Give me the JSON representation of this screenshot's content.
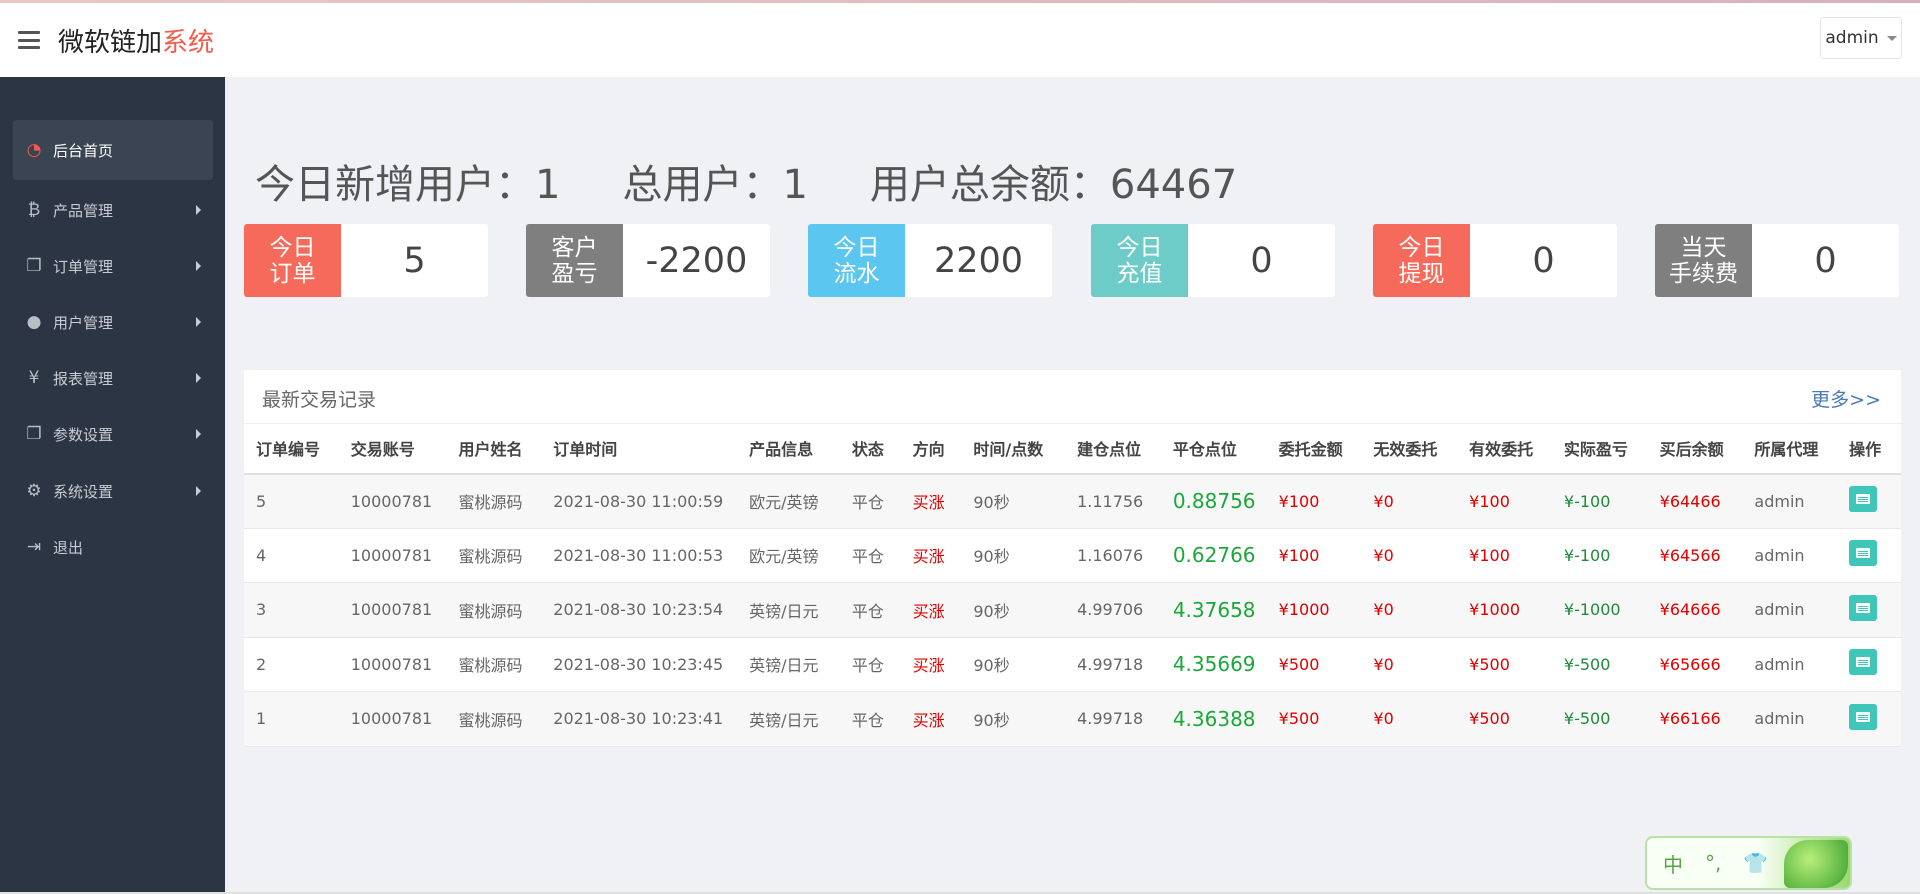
{
  "header": {
    "logo_main": "微软链加",
    "logo_accent": "系统",
    "user": "admin"
  },
  "sidebar": {
    "items": [
      {
        "label": "后台首页",
        "icon": "dashboard-icon",
        "glyph": "◔",
        "active": true
      },
      {
        "label": "产品管理",
        "icon": "bitcoin-icon",
        "glyph": "₿"
      },
      {
        "label": "订单管理",
        "icon": "copy-icon",
        "glyph": "❐"
      },
      {
        "label": "用户管理",
        "icon": "user-icon",
        "glyph": "●"
      },
      {
        "label": "报表管理",
        "icon": "yen-icon",
        "glyph": "¥"
      },
      {
        "label": "参数设置",
        "icon": "copy-icon",
        "glyph": "❐"
      },
      {
        "label": "系统设置",
        "icon": "gears-icon",
        "glyph": "⚙"
      },
      {
        "label": "退出",
        "icon": "sign-out-icon",
        "glyph": "⇥"
      }
    ]
  },
  "summary": {
    "new_users_label": "今日新增用户：",
    "new_users": "1",
    "total_users_label": "总用户：",
    "total_users": "1",
    "balance_label": "用户总余额：",
    "balance": "64467"
  },
  "stats": [
    {
      "label": "今日\n订单",
      "value": "5",
      "color": "#f56a5a"
    },
    {
      "label": "客户\n盈亏",
      "value": "-2200",
      "color": "#7f7f7f"
    },
    {
      "label": "今日\n流水",
      "value": "2200",
      "color": "#5bc6ef"
    },
    {
      "label": "今日\n充值",
      "value": "0",
      "color": "#6dcbc8"
    },
    {
      "label": "今日\n提现",
      "value": "0",
      "color": "#f56a5a"
    },
    {
      "label": "当天\n手续费",
      "value": "0",
      "color": "#7f7f7f"
    }
  ],
  "trades": {
    "title": "最新交易记录",
    "more": "更多>>",
    "columns": [
      "订单编号",
      "交易账号",
      "用户姓名",
      "订单时间",
      "产品信息",
      "状态",
      "方向",
      "时间/点数",
      "建仓点位",
      "平仓点位",
      "委托金额",
      "无效委托",
      "有效委托",
      "实际盈亏",
      "买后余额",
      "所属代理",
      "操作"
    ],
    "rows": [
      [
        "5",
        "10000781",
        "蜜桃源码",
        "2021-08-30 11:00:59",
        "欧元/英镑",
        "平仓",
        "买涨",
        "90秒",
        "1.11756",
        "0.88756",
        "¥100",
        "¥0",
        "¥100",
        "¥-100",
        "¥64466",
        "admin"
      ],
      [
        "4",
        "10000781",
        "蜜桃源码",
        "2021-08-30 11:00:53",
        "欧元/英镑",
        "平仓",
        "买涨",
        "90秒",
        "1.16076",
        "0.62766",
        "¥100",
        "¥0",
        "¥100",
        "¥-100",
        "¥64566",
        "admin"
      ],
      [
        "3",
        "10000781",
        "蜜桃源码",
        "2021-08-30 10:23:54",
        "英镑/日元",
        "平仓",
        "买涨",
        "90秒",
        "4.99706",
        "4.37658",
        "¥1000",
        "¥0",
        "¥1000",
        "¥-1000",
        "¥64666",
        "admin"
      ],
      [
        "2",
        "10000781",
        "蜜桃源码",
        "2021-08-30 10:23:45",
        "英镑/日元",
        "平仓",
        "买涨",
        "90秒",
        "4.99718",
        "4.35669",
        "¥500",
        "¥0",
        "¥500",
        "¥-500",
        "¥65666",
        "admin"
      ],
      [
        "1",
        "10000781",
        "蜜桃源码",
        "2021-08-30 10:23:41",
        "英镑/日元",
        "平仓",
        "买涨",
        "90秒",
        "4.99718",
        "4.36388",
        "¥500",
        "¥0",
        "¥500",
        "¥-500",
        "¥66166",
        "admin"
      ]
    ]
  },
  "ime": {
    "items": [
      "中",
      "°,",
      "👕"
    ]
  }
}
